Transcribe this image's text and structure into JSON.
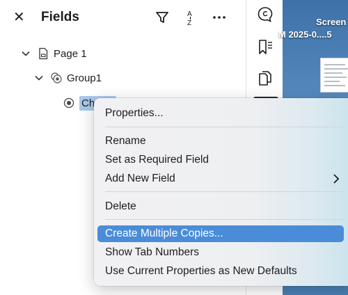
{
  "panel": {
    "title": "Fields",
    "tree": {
      "page_label": "Page 1",
      "group_label": "Group1",
      "choice_label": "Choice"
    }
  },
  "desktop": {
    "label_1": "Screen",
    "label_2": "M  2025-0....5"
  },
  "context_menu": {
    "items": [
      {
        "label": "Properties..."
      },
      {
        "label": "Rename"
      },
      {
        "label": "Set as Required Field"
      },
      {
        "label": "Add New Field"
      },
      {
        "label": "Delete"
      },
      {
        "label": "Create Multiple Copies..."
      },
      {
        "label": "Show Tab Numbers"
      },
      {
        "label": "Use Current Properties as New Defaults"
      }
    ],
    "highlighted": "Create Multiple Copies..."
  },
  "icons": {
    "header": [
      "close-icon",
      "filter-icon",
      "sort-az-icon",
      "more-icon"
    ],
    "toolbar": [
      "comment-icon",
      "bookmark-icon",
      "copy-pages-icon"
    ],
    "tree": [
      "chevron-down-icon",
      "page-icon",
      "radio-group-icon",
      "radio-button-icon"
    ]
  },
  "colors": {
    "selection": "#a9c7ea",
    "menu_highlight": "#4a8cd8",
    "desktop": "#4a7fb5"
  }
}
